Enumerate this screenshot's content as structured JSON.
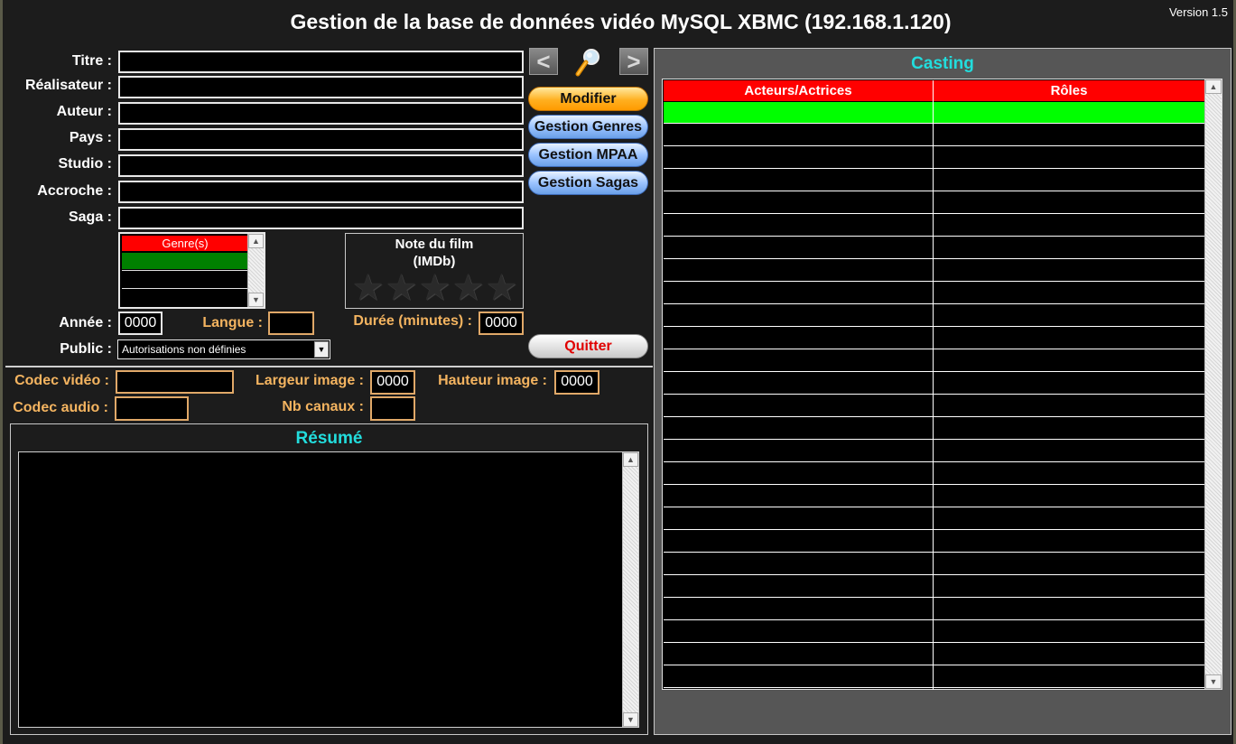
{
  "window": {
    "title": "Gestion de la base de données vidéo MySQL XBMC (192.168.1.120)",
    "version": "Version 1.5"
  },
  "form": {
    "labels": {
      "titre": "Titre :",
      "realisateur": "Réalisateur :",
      "auteur": "Auteur :",
      "pays": "Pays :",
      "studio": "Studio :",
      "accroche": "Accroche :",
      "saga": "Saga :",
      "annee": "Année :",
      "langue": "Langue :",
      "duree": "Durée (minutes) :",
      "public": "Public :"
    },
    "values": {
      "titre": "",
      "realisateur": "",
      "auteur": "",
      "pays": "",
      "studio": "",
      "accroche": "",
      "saga": "",
      "annee": "0000",
      "langue": "",
      "duree": "0000",
      "public": "Autorisations non définies"
    },
    "genres": {
      "header": "Genre(s)",
      "items": []
    }
  },
  "rating": {
    "title_line1": "Note du film",
    "title_line2": "(IMDb)",
    "max_stars": 5,
    "value": 0
  },
  "buttons": {
    "prev": "<",
    "next": ">",
    "search_icon": "magnifier-icon",
    "modifier": "Modifier",
    "gestion_genres": "Gestion Genres",
    "gestion_mpaa": "Gestion MPAA",
    "gestion_sagas": "Gestion Sagas",
    "quitter": "Quitter"
  },
  "tech": {
    "labels": {
      "codec_video": "Codec vidéo :",
      "codec_audio": "Codec audio :",
      "largeur": "Largeur image :",
      "hauteur": "Hauteur image :",
      "nb_canaux": "Nb canaux :"
    },
    "values": {
      "codec_video": "",
      "codec_audio": "",
      "largeur": "0000",
      "hauteur": "0000",
      "nb_canaux": ""
    }
  },
  "resume": {
    "title": "Résumé",
    "text": ""
  },
  "casting": {
    "title": "Casting",
    "columns": [
      "Acteurs/Actrices",
      "Rôles"
    ],
    "rows": []
  },
  "colors": {
    "accent_cyan": "#22dddd",
    "header_red": "#ff0000",
    "selection_green": "#00ff00",
    "orange_label": "#f4b460"
  }
}
